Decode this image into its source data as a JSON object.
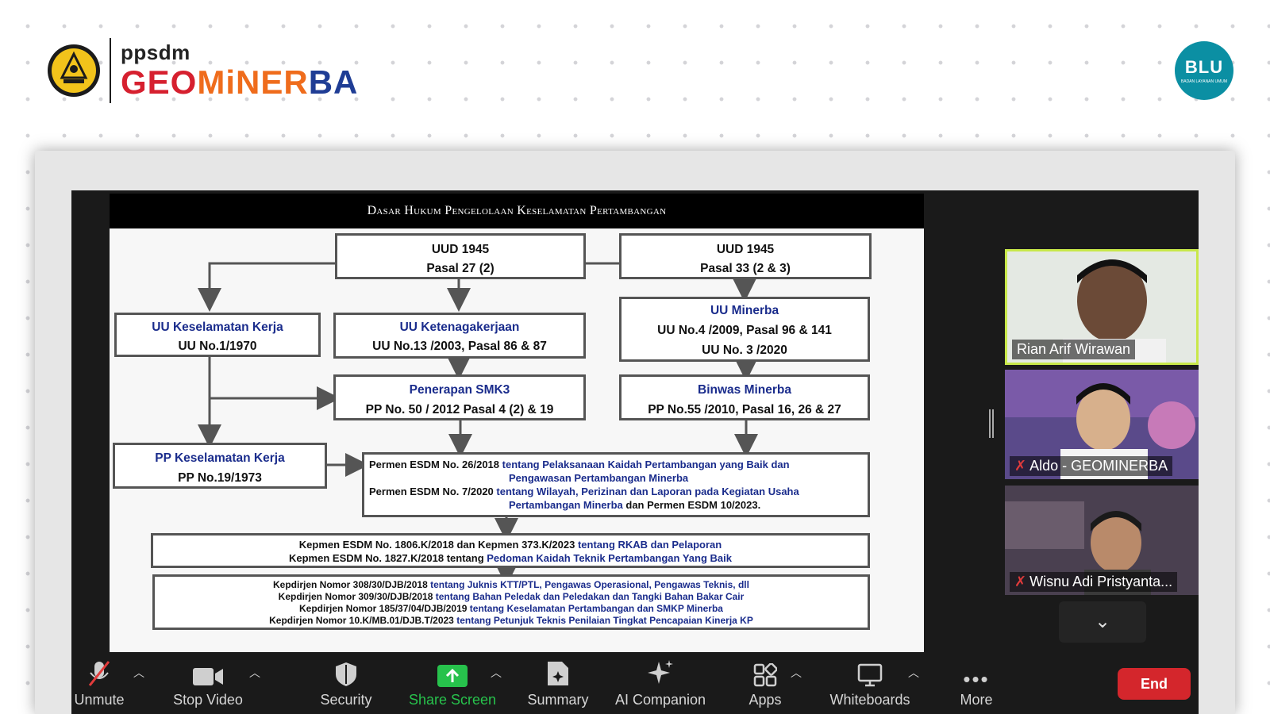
{
  "header": {
    "brand_top": "ppsdm",
    "brand_main_1": "GEO",
    "brand_main_2": "MiNER",
    "brand_main_3": "BA",
    "blu_text": "BLU",
    "blu_sub": "BADAN LAYANAN UMUM"
  },
  "slide": {
    "title": "Dasar Hukum Pengelolaan Keselamatan Pertambangan",
    "uud1_line1": "UUD 1945",
    "uud1_line2": "Pasal 27 (2)",
    "uud2_line1": "UUD 1945",
    "uud2_line2": "Pasal 33 (2 & 3)",
    "uukk_title": "UU Keselamatan Kerja",
    "uukk_sub": "UU No.1/1970",
    "uuket_title": "UU Ketenagakerjaan",
    "uuket_sub": "UU No.13 /2003, Pasal 86 & 87",
    "uumin_title": "UU Minerba",
    "uumin_sub1": "UU No.4 /2009, Pasal 96 & 141",
    "uumin_sub2": "UU No. 3 /2020",
    "smk3_title": "Penerapan SMK3",
    "smk3_sub": "PP No. 50 / 2012 Pasal 4 (2) & 19",
    "binwas_title": "Binwas Minerba",
    "binwas_sub": "PP No.55 /2010, Pasal 16, 26 & 27",
    "ppkk_title": "PP Keselamatan Kerja",
    "ppkk_sub": "PP No.19/1973",
    "permen_1a": "Permen ESDM No. 26/2018",
    "permen_1b": "tentang Pelaksanaan  Kaidah Pertambangan yang Baik dan",
    "permen_1c": "Pengawasan Pertambangan Minerba",
    "permen_2a": "Permen ESDM No. 7/2020",
    "permen_2b": "tentang Wilayah, Perizinan dan Laporan pada Kegiatan Usaha",
    "permen_2c": "Pertambangan Minerba",
    "permen_2d": "dan Permen ESDM 10/2023.",
    "kepmen_1a": "Kepmen ESDM No. 1806.K/2018 dan Kepmen 373.K/2023",
    "kepmen_1b": "tentang RKAB dan Pelaporan",
    "kepmen_2a": "Kepmen ESDM No. 1827.K/2018 tentang",
    "kepmen_2b": "Pedoman Kaidah Teknik Pertambangan Yang Baik",
    "kepdir_1a": "Kepdirjen Nomor 308/30/DJB/2018",
    "kepdir_1b": "tentang Juknis KTT/PTL, Pengawas Operasional, Pengawas Teknis, dll",
    "kepdir_2a": "Kepdirjen Nomor 309/30/DJB/2018",
    "kepdir_2b": "tentang Bahan Peledak dan Peledakan dan Tangki Bahan Bakar Cair",
    "kepdir_3a": "Kepdirjen Nomor 185/37/04/DJB/2019",
    "kepdir_3b": "tentang Keselamatan Pertambangan dan SMKP Minerba",
    "kepdir_4a": "Kepdirjen Nomor 10.K/MB.01/DJB.T/2023",
    "kepdir_4b": "tentang Petunjuk Teknis Penilaian Tingkat Pencapaian Kinerja KP"
  },
  "participants": [
    {
      "name": "Rian Arif Wirawan"
    },
    {
      "name": "Aldo - GEOMINERBA"
    },
    {
      "name": "Wisnu Adi Pristyanta..."
    }
  ],
  "toolbar": {
    "unmute": "Unmute",
    "stop_video": "Stop Video",
    "security": "Security",
    "share_screen": "Share Screen",
    "summary": "Summary",
    "ai_companion": "AI Companion",
    "apps": "Apps",
    "whiteboards": "Whiteboards",
    "more": "More",
    "end": "End"
  },
  "colors": {
    "share_green": "#27c24c",
    "end_red": "#d4262c",
    "active_speaker": "#c8e84a",
    "slide_blue": "#1a2c8c"
  }
}
